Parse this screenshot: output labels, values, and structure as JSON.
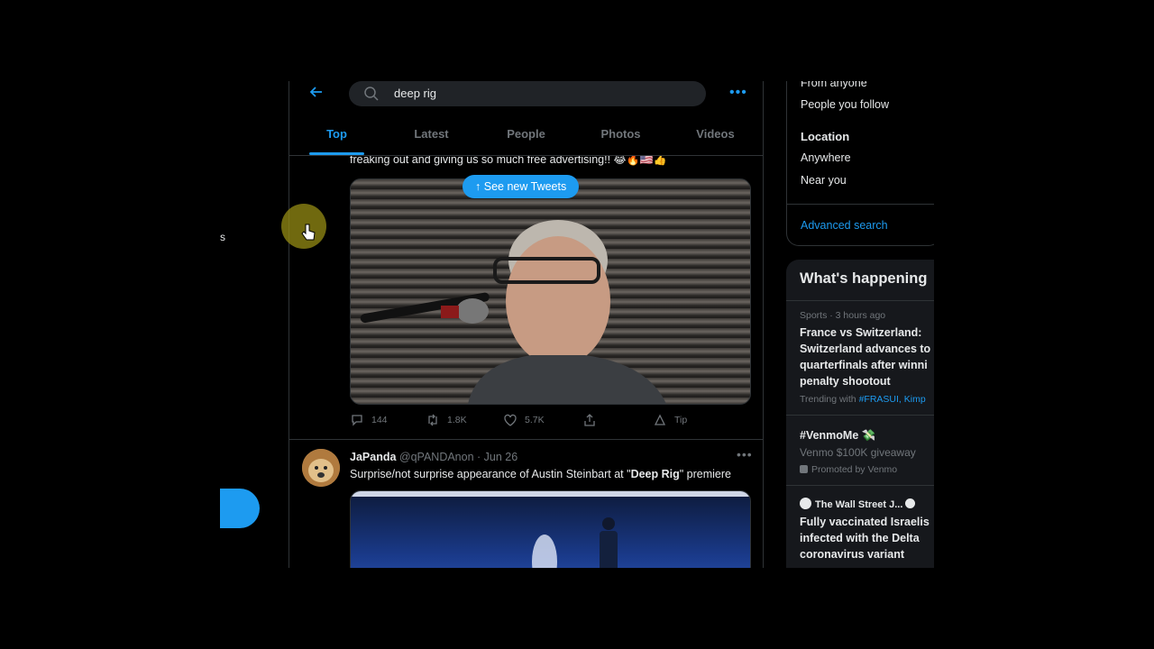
{
  "nav": {
    "fragment_text": "s"
  },
  "search": {
    "query": "deep rig"
  },
  "tabs": [
    {
      "label": "Top",
      "active": true
    },
    {
      "label": "Latest",
      "active": false
    },
    {
      "label": "People",
      "active": false
    },
    {
      "label": "Photos",
      "active": false
    },
    {
      "label": "Videos",
      "active": false
    }
  ],
  "banner": {
    "label": "See new Tweets"
  },
  "tweet1": {
    "text": "freaking out and giving us so much free advertising!!",
    "emojis": "😂🔥🇺🇸👍",
    "replies": "144",
    "retweets": "1.8K",
    "likes": "5.7K",
    "tip_label": "Tip"
  },
  "tweet2": {
    "name": "JaPanda",
    "handle": "@qPANDAnon",
    "date": "· Jun 26",
    "text_before": "Surprise/not surprise appearance of Austin Steinbart at \"",
    "text_bold": "Deep Rig",
    "text_after": "\" premiere"
  },
  "filters": {
    "from_anyone": "From anyone",
    "people_you_follow": "People you follow",
    "location_heading": "Location",
    "anywhere": "Anywhere",
    "near_you": "Near you",
    "advanced_search": "Advanced search"
  },
  "trends": {
    "title": "What's happening",
    "items": [
      {
        "meta": "Sports · 3 hours ago",
        "lines": [
          "France vs Switzerland:",
          "Switzerland advances to",
          "quarterfinals after winni",
          "penalty shootout"
        ],
        "trending_prefix": "Trending with ",
        "trending_tags": "#FRASUI, Kimp"
      },
      {
        "title": "#VenmoMe 💸",
        "subtitle": "Venmo $100K giveaway",
        "promoted": "Promoted by Venmo"
      },
      {
        "source": "The Wall Street J...",
        "lines": [
          "Fully vaccinated Israelis",
          "infected with the Delta",
          "coronavirus variant"
        ]
      }
    ]
  },
  "colors": {
    "accent": "#1d9bf0",
    "background": "#000000",
    "muted": "#71767b"
  }
}
